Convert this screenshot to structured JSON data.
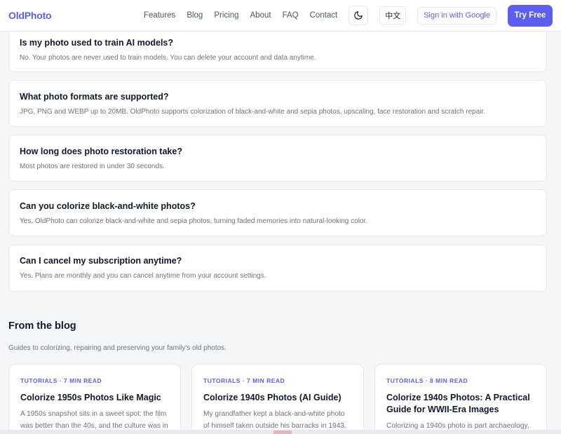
{
  "nav": {
    "logo": "OldPhoto",
    "links": [
      "Features",
      "Blog",
      "Pricing",
      "About",
      "FAQ",
      "Contact"
    ],
    "theme_icon": "moon-icon",
    "lang": "中文",
    "google": "Sign in with Google",
    "try_free": "Try Free"
  },
  "faq": [
    {
      "q": "Is my photo used to train AI models?",
      "a": "No. Your photos are never used to train models. You can delete your account and data anytime."
    },
    {
      "q": "What photo formats are supported?",
      "a": "JPG, PNG and WEBP up to 20MB. OldPhoto supports colorization of black-and-white and sepia photos, upscaling, face restoration and scratch repair."
    },
    {
      "q": "How long does photo restoration take?",
      "a": "Most photos are restored in under 30 seconds."
    },
    {
      "q": "Can you colorize black-and-white photos?",
      "a": "Yes. OldPhoto can colorize black-and-white and sepia photos, turning faded memories into natural-looking color."
    },
    {
      "q": "Can I cancel my subscription anytime?",
      "a": "Yes. Plans are monthly and you can cancel anytime from your account settings."
    }
  ],
  "blog": {
    "title": "From the blog",
    "subtitle": "Guides to colorizing, repairing and preserving your family's old photos.",
    "cards": [
      {
        "tag": "TUTORIALS · 7 MIN READ",
        "title": "Colorize 1950s Photos Like Magic",
        "excerpt": "A 1950s snapshot sits in a sweet spot: the film was better than the 40s, and the culture was in"
      },
      {
        "tag": "TUTORIALS · 7 MIN READ",
        "title": "Colorize 1940s Photos (AI Guide)",
        "excerpt": "My grandfather kept a black-and-white photo of himself taken outside his barracks in 1943."
      },
      {
        "tag": "TUTORIALS · 8 MIN READ",
        "title": "Colorize 1940s Photos: A Practical Guide for WWII-Era Images",
        "excerpt": "Colorizing a 1940s photo is part archaeology,"
      }
    ]
  },
  "colors": {
    "accent": "#5b5ef0",
    "background": "#f5f6f8"
  }
}
